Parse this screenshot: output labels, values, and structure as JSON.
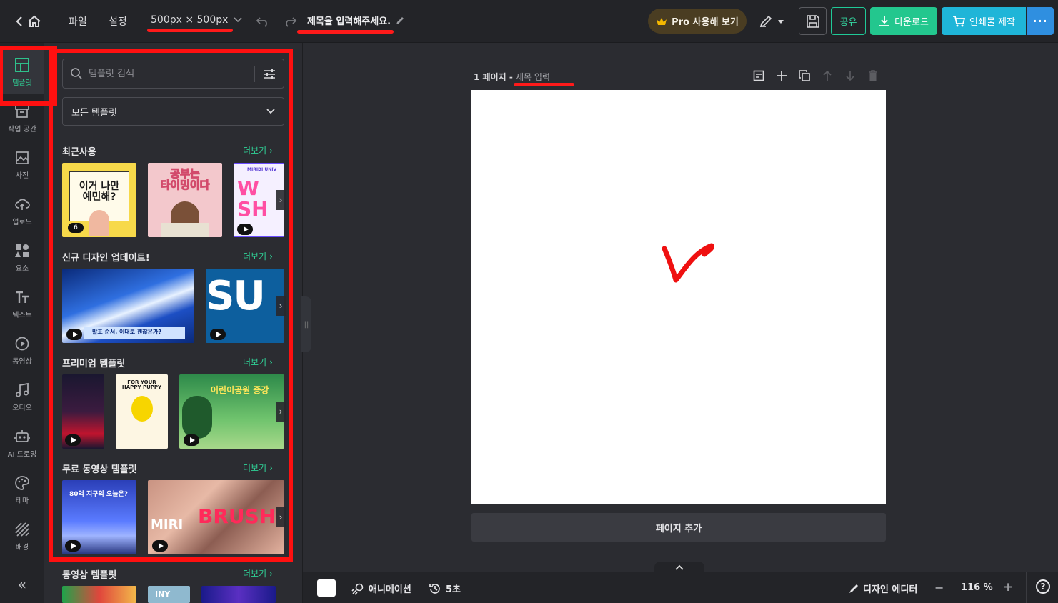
{
  "topbar": {
    "menu_file": "파일",
    "menu_settings": "설정",
    "size_label": "500px × 500px",
    "doc_title": "제목을 입력해주세요.",
    "pro_label": "Pro 사용해 보기",
    "share_label": "공유",
    "download_label": "다운로드",
    "print_label": "인쇄물 제작",
    "more_label": "···"
  },
  "rail": {
    "items": [
      {
        "label": "템플릿",
        "icon": "layout-icon"
      },
      {
        "label": "작업 공간",
        "icon": "archive-icon"
      },
      {
        "label": "사진",
        "icon": "image-icon"
      },
      {
        "label": "업로드",
        "icon": "upload-cloud-icon"
      },
      {
        "label": "요소",
        "icon": "shapes-icon"
      },
      {
        "label": "텍스트",
        "icon": "text-icon"
      },
      {
        "label": "동영상",
        "icon": "play-circle-icon"
      },
      {
        "label": "오디오",
        "icon": "music-icon"
      },
      {
        "label": "AI 드로잉",
        "icon": "robot-icon"
      },
      {
        "label": "테마",
        "icon": "palette-icon"
      },
      {
        "label": "배경",
        "icon": "hatch-icon"
      }
    ],
    "collapse": "«"
  },
  "panel": {
    "search_placeholder": "템플릿 검색",
    "select_value": "모든 템플릿",
    "more_label": "더보기",
    "sections": [
      {
        "title": "최근사용"
      },
      {
        "title": "신규 디자인 업데이트!"
      },
      {
        "title": "프리미엄 템플릿"
      },
      {
        "title": "무료 동영상 템플릿"
      },
      {
        "title": "동영상 템플릿"
      }
    ],
    "thumbs": {
      "t1_text": "이거 나만\n예민해?",
      "t1_count": "6",
      "t2_text": "공부는\n타이밍이다",
      "t3_text": "W\nSH",
      "t3_small": "MIRIDI UNIV",
      "t4_caption": "발표 순서, 이대로 괜찮은가?",
      "t5_text": "SU",
      "t7_text": "FOR YOUR HAPPY PUPPY",
      "t8_text": "어린이공원 증강",
      "t9_text": "80억 지구의 오늘은?",
      "t10_text": "BRUSH",
      "t10_left": "MIRI",
      "t13_text": "INY"
    }
  },
  "canvas": {
    "page_number": "1 페이지 - ",
    "page_title_placeholder": "제목 입력",
    "add_page_label": "페이지 추가"
  },
  "bottombar": {
    "animation_label": "애니메이션",
    "duration_label": "5초",
    "design_editor_label": "디자인 에디터",
    "zoom_minus": "−",
    "zoom_value": "116 %",
    "zoom_plus": "+",
    "help": "?"
  },
  "colors": {
    "accent": "#2fd196",
    "annotation_red": "#ff1010"
  }
}
